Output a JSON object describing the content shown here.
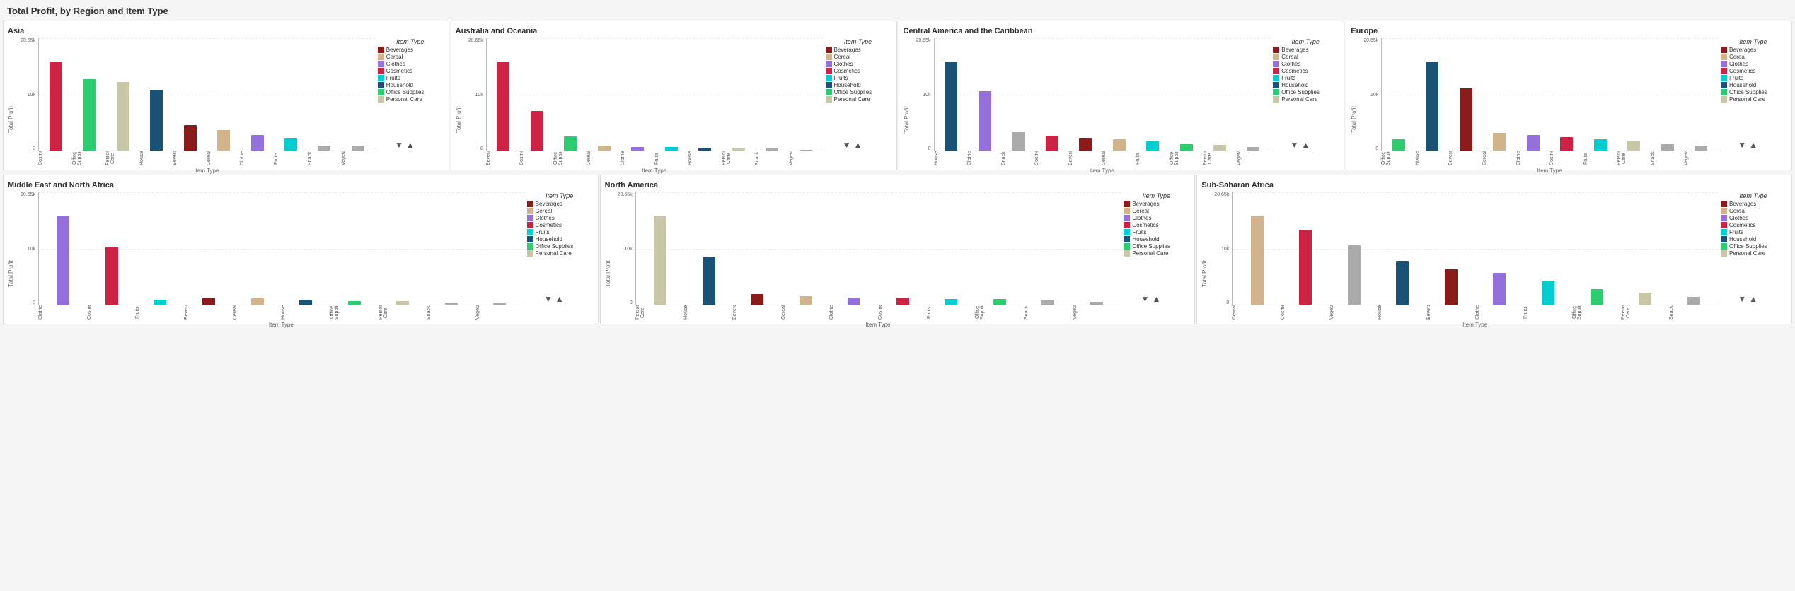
{
  "pageTitle": "Total Profit, by Region and Item Type",
  "colors": {
    "Beverages": "#8B1A1A",
    "Cereal": "#D2B48C",
    "Clothes": "#9370DB",
    "Cosmetics": "#CC2244",
    "Fruits": "#00CED1",
    "Household": "#1A5276",
    "Office Supplies": "#2ECC71",
    "Personal Care": "#C8C8A9",
    "Snacks": "#AAA",
    "Vegetables": "#AAA"
  },
  "legendItems": [
    "Beverages",
    "Cereal",
    "Clothes",
    "Cosmetics",
    "Fruits",
    "Household",
    "Office Supplies",
    "Personal Care"
  ],
  "yAxisLabels": [
    "20.65k",
    "10k",
    "0"
  ],
  "chartHeight": 120,
  "charts": [
    {
      "id": "asia",
      "title": "Asia",
      "xAxisTitle": "Item Type",
      "bars": [
        {
          "label": "Cosmetics",
          "value": 35,
          "color": "#CC2244"
        },
        {
          "label": "Office Supplies",
          "value": 28,
          "color": "#2ECC71"
        },
        {
          "label": "Personal Care",
          "value": 27,
          "color": "#C8C8A9"
        },
        {
          "label": "Household",
          "value": 24,
          "color": "#1A5276"
        },
        {
          "label": "Beverages",
          "value": 10,
          "color": "#8B1A1A"
        },
        {
          "label": "Cereal",
          "value": 8,
          "color": "#D2B48C"
        },
        {
          "label": "Clothes",
          "value": 6,
          "color": "#9370DB"
        },
        {
          "label": "Fruits",
          "value": 5,
          "color": "#00CED1"
        },
        {
          "label": "Snacks",
          "value": 2,
          "color": "#AAA"
        },
        {
          "label": "Vegetables",
          "value": 2,
          "color": "#AAA"
        }
      ]
    },
    {
      "id": "australia",
      "title": "Australia and Oceania",
      "xAxisTitle": "Item Type",
      "bars": [
        {
          "label": "Beverages",
          "value": 95,
          "color": "#CC2244"
        },
        {
          "label": "Cosmetics",
          "value": 42,
          "color": "#CC2244"
        },
        {
          "label": "Office Supplies",
          "value": 15,
          "color": "#2ECC71"
        },
        {
          "label": "Cereal",
          "value": 5,
          "color": "#D2B48C"
        },
        {
          "label": "Clothes",
          "value": 4,
          "color": "#9370DB"
        },
        {
          "label": "Fruits",
          "value": 4,
          "color": "#00CED1"
        },
        {
          "label": "Household",
          "value": 3,
          "color": "#1A5276"
        },
        {
          "label": "Personal Care",
          "value": 3,
          "color": "#C8C8A9"
        },
        {
          "label": "Snacks",
          "value": 2,
          "color": "#AAA"
        },
        {
          "label": "Vegetables",
          "value": 1,
          "color": "#AAA"
        }
      ]
    },
    {
      "id": "central-america",
      "title": "Central America and the Caribbean",
      "xAxisTitle": "Item Type",
      "bars": [
        {
          "label": "Household",
          "value": 48,
          "color": "#1A5276"
        },
        {
          "label": "Clothes",
          "value": 32,
          "color": "#9370DB"
        },
        {
          "label": "Snacks",
          "value": 10,
          "color": "#AAA"
        },
        {
          "label": "Cosmetics",
          "value": 8,
          "color": "#CC2244"
        },
        {
          "label": "Beverages",
          "value": 7,
          "color": "#8B1A1A"
        },
        {
          "label": "Cereal",
          "value": 6,
          "color": "#D2B48C"
        },
        {
          "label": "Fruits",
          "value": 5,
          "color": "#00CED1"
        },
        {
          "label": "Office Supplies",
          "value": 4,
          "color": "#2ECC71"
        },
        {
          "label": "Personal Care",
          "value": 3,
          "color": "#C8C8A9"
        },
        {
          "label": "Vegetables",
          "value": 2,
          "color": "#AAA"
        }
      ]
    },
    {
      "id": "europe",
      "title": "Europe",
      "xAxisTitle": "Item Type",
      "bars": [
        {
          "label": "Office Supplies",
          "value": 5,
          "color": "#2ECC71"
        },
        {
          "label": "Household",
          "value": 40,
          "color": "#1A5276"
        },
        {
          "label": "Beverages",
          "value": 28,
          "color": "#8B1A1A"
        },
        {
          "label": "Cereal",
          "value": 8,
          "color": "#D2B48C"
        },
        {
          "label": "Clothes",
          "value": 7,
          "color": "#9370DB"
        },
        {
          "label": "Cosmetics",
          "value": 6,
          "color": "#CC2244"
        },
        {
          "label": "Fruits",
          "value": 5,
          "color": "#00CED1"
        },
        {
          "label": "Personal Care",
          "value": 4,
          "color": "#C8C8A9"
        },
        {
          "label": "Snacks",
          "value": 3,
          "color": "#AAA"
        },
        {
          "label": "Vegetables",
          "value": 2,
          "color": "#AAA"
        }
      ]
    },
    {
      "id": "middle-east",
      "title": "Middle East and North Africa",
      "xAxisTitle": "Item Type",
      "bars": [
        {
          "label": "Clothes",
          "value": 72,
          "color": "#9370DB"
        },
        {
          "label": "Cosmetics",
          "value": 47,
          "color": "#CC2244"
        },
        {
          "label": "Fruits",
          "value": 4,
          "color": "#00CED1"
        },
        {
          "label": "Beverages",
          "value": 6,
          "color": "#8B1A1A"
        },
        {
          "label": "Cereal",
          "value": 5,
          "color": "#D2B48C"
        },
        {
          "label": "Household",
          "value": 4,
          "color": "#1A5276"
        },
        {
          "label": "Office Supplies",
          "value": 3,
          "color": "#2ECC71"
        },
        {
          "label": "Personal Care",
          "value": 3,
          "color": "#C8C8A9"
        },
        {
          "label": "Snacks",
          "value": 2,
          "color": "#AAA"
        },
        {
          "label": "Vegetables",
          "value": 1,
          "color": "#AAA"
        }
      ]
    },
    {
      "id": "north-america",
      "title": "North America",
      "xAxisTitle": "Item Type",
      "bars": [
        {
          "label": "Personal Care",
          "value": 65,
          "color": "#C8C8A9"
        },
        {
          "label": "Household",
          "value": 35,
          "color": "#1A5276"
        },
        {
          "label": "Beverages",
          "value": 8,
          "color": "#8B1A1A"
        },
        {
          "label": "Cereal",
          "value": 6,
          "color": "#D2B48C"
        },
        {
          "label": "Clothes",
          "value": 5,
          "color": "#9370DB"
        },
        {
          "label": "Cosmetics",
          "value": 5,
          "color": "#CC2244"
        },
        {
          "label": "Fruits",
          "value": 4,
          "color": "#00CED1"
        },
        {
          "label": "Office Supplies",
          "value": 4,
          "color": "#2ECC71"
        },
        {
          "label": "Snacks",
          "value": 3,
          "color": "#AAA"
        },
        {
          "label": "Vegetables",
          "value": 2,
          "color": "#AAA"
        }
      ]
    },
    {
      "id": "sub-saharan",
      "title": "Sub-Saharan Africa",
      "xAxisTitle": "Item Type",
      "bars": [
        {
          "label": "Cereal",
          "value": 45,
          "color": "#D2B48C"
        },
        {
          "label": "Cosmetics",
          "value": 38,
          "color": "#CC2244"
        },
        {
          "label": "Vegetables",
          "value": 30,
          "color": "#AAA"
        },
        {
          "label": "Household",
          "value": 22,
          "color": "#1A5276"
        },
        {
          "label": "Beverages",
          "value": 18,
          "color": "#8B1A1A"
        },
        {
          "label": "Clothes",
          "value": 16,
          "color": "#9370DB"
        },
        {
          "label": "Fruits",
          "value": 12,
          "color": "#00CED1"
        },
        {
          "label": "Office Supplies",
          "value": 8,
          "color": "#2ECC71"
        },
        {
          "label": "Personal Care",
          "value": 6,
          "color": "#C8C8A9"
        },
        {
          "label": "Snacks",
          "value": 4,
          "color": "#AAA"
        }
      ]
    }
  ],
  "sortControls": {
    "down": "▼",
    "up": "▲"
  },
  "labels": {
    "itemType": "Item Type",
    "totalProfit": "Total Profit",
    "yAxisTop": "20.65k",
    "yAxisMid": "10k",
    "yAxisBot": "0"
  }
}
